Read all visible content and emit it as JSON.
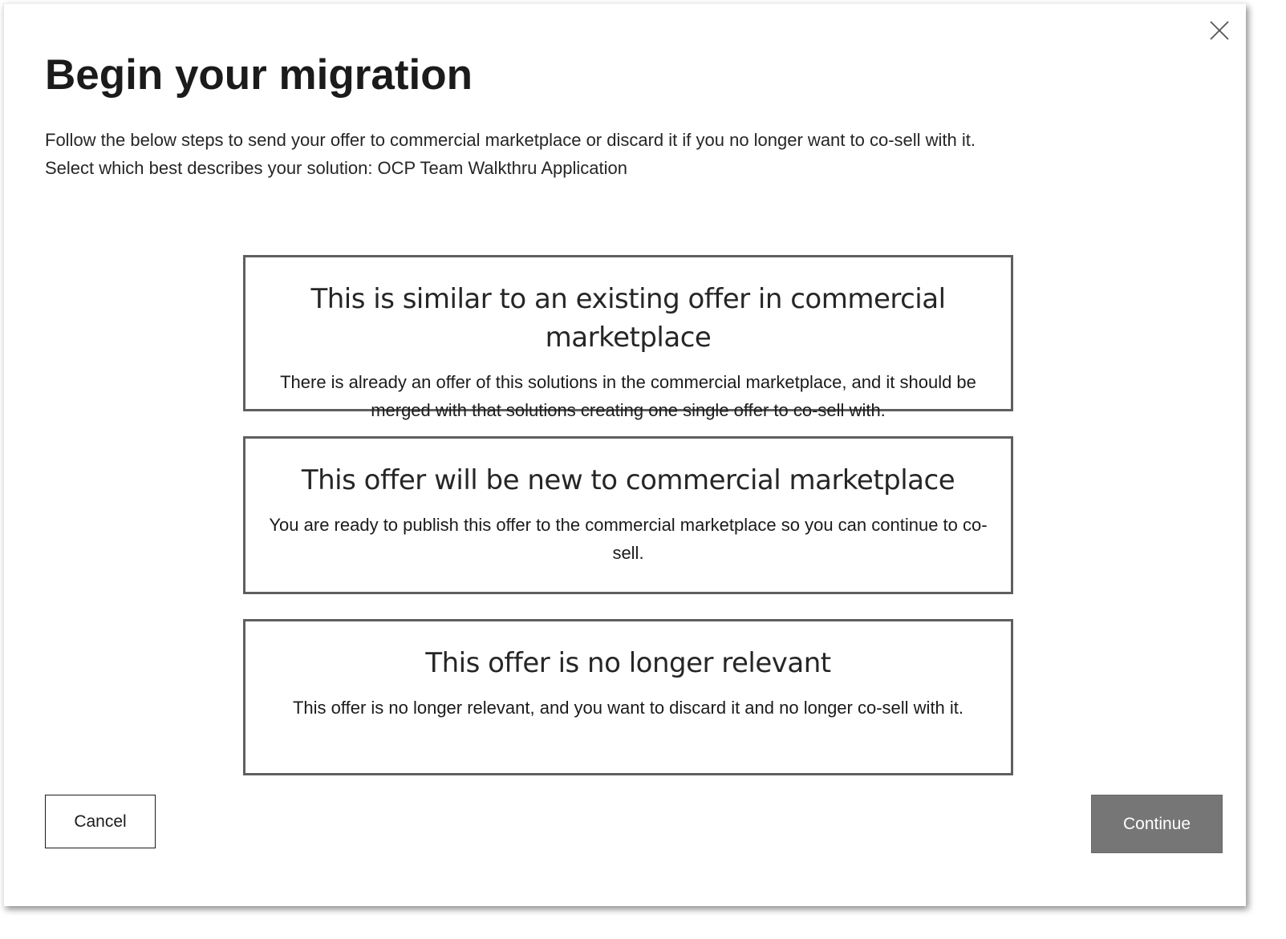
{
  "dialog": {
    "title": "Begin your migration",
    "description_line1": "Follow the below steps to send your offer to commercial marketplace or discard it if you no longer want to co-sell with it.",
    "description_line2": "Select which best describes your solution: OCP Team Walkthru Application",
    "close_icon": "close-icon"
  },
  "options": [
    {
      "title": "This is similar to an existing offer in commercial marketplace",
      "description": "There is already an offer of this solutions in the commercial marketplace, and it should be merged with that solutions creating one single offer to co-sell with."
    },
    {
      "title": "This offer will be new to commercial marketplace",
      "description": "You are ready to publish this offer to the commercial marketplace so you can continue to co-sell."
    },
    {
      "title": "This offer is no longer relevant",
      "description": "This offer is no longer relevant, and you want to discard it and no longer co-sell with it."
    }
  ],
  "footer": {
    "cancel_label": "Cancel",
    "continue_label": "Continue"
  },
  "colors": {
    "continue_bg": "#767676",
    "option_border": "#5f5f5f"
  }
}
